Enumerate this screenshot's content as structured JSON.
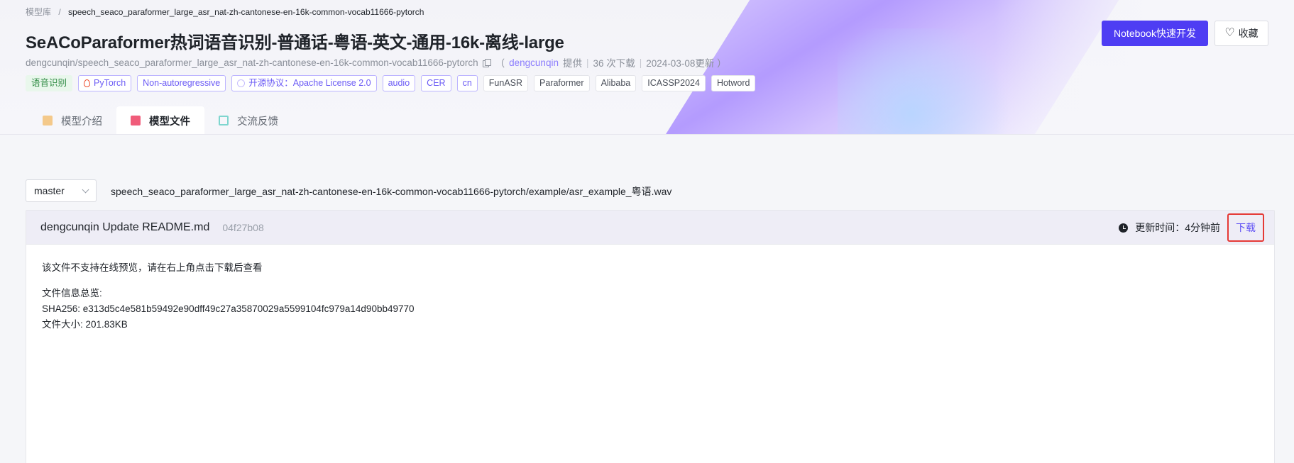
{
  "breadcrumb": {
    "home": "模型库",
    "separator": "/",
    "current": "speech_seaco_paraformer_large_asr_nat-zh-cantonese-en-16k-common-vocab11666-pytorch"
  },
  "model": {
    "title": "SeACoParaformer热词语音识别-普通话-粤语-英文-通用-16k-离线-large",
    "id": "dengcunqin/speech_seaco_paraformer_large_asr_nat-zh-cantonese-en-16k-common-vocab11666-pytorch",
    "provider_open": "（",
    "provider": "dengcunqin",
    "provided_suffix": "提供",
    "downloads": "36 次下载",
    "updated": "2024-03-08更新 ）"
  },
  "tags": [
    {
      "label": "语音识别",
      "style": "cat"
    },
    {
      "label": "PyTorch",
      "style": "purple",
      "icon": "pytorch-icon"
    },
    {
      "label": "Non-autoregressive",
      "style": "purple"
    },
    {
      "label": "开源协议：Apache License 2.0",
      "style": "purple",
      "icon": "license-icon"
    },
    {
      "label": "audio",
      "style": "purple"
    },
    {
      "label": "CER",
      "style": "purple"
    },
    {
      "label": "cn",
      "style": "purple"
    },
    {
      "label": "FunASR",
      "style": "plain"
    },
    {
      "label": "Paraformer",
      "style": "plain"
    },
    {
      "label": "Alibaba",
      "style": "plain"
    },
    {
      "label": "ICASSP2024",
      "style": "plain"
    },
    {
      "label": "Hotword",
      "style": "plain"
    }
  ],
  "actions": {
    "notebook": "Notebook快速开发",
    "favorite": "收藏"
  },
  "tabs": [
    {
      "label": "模型介绍",
      "icon": "package-icon",
      "active": false
    },
    {
      "label": "模型文件",
      "icon": "book-icon",
      "active": true
    },
    {
      "label": "交流反馈",
      "icon": "edit-icon",
      "active": false
    }
  ],
  "branch": "master",
  "file_path": "speech_seaco_paraformer_large_asr_nat-zh-cantonese-en-16k-common-vocab11666-pytorch/example/asr_example_粤语.wav",
  "commit": {
    "message": "dengcunqin Update README.md",
    "hash": "04f27b08",
    "updated_label": "更新时间：4分钟前",
    "download": "下载"
  },
  "file_info": {
    "notice": "该文件不支持在线预览，请在右上角点击下载后查看",
    "overview_label": "文件信息总览:",
    "sha256": "SHA256: e313d5c4e581b59492e90dff49c27a35870029a5599104fc979a14d90bb49770",
    "size": "文件大小: 201.83KB"
  },
  "colors": {
    "accent": "#4e3df3",
    "link": "#5e4ff5",
    "highlight_border": "#e53935",
    "category_green": "#2f8b43"
  }
}
